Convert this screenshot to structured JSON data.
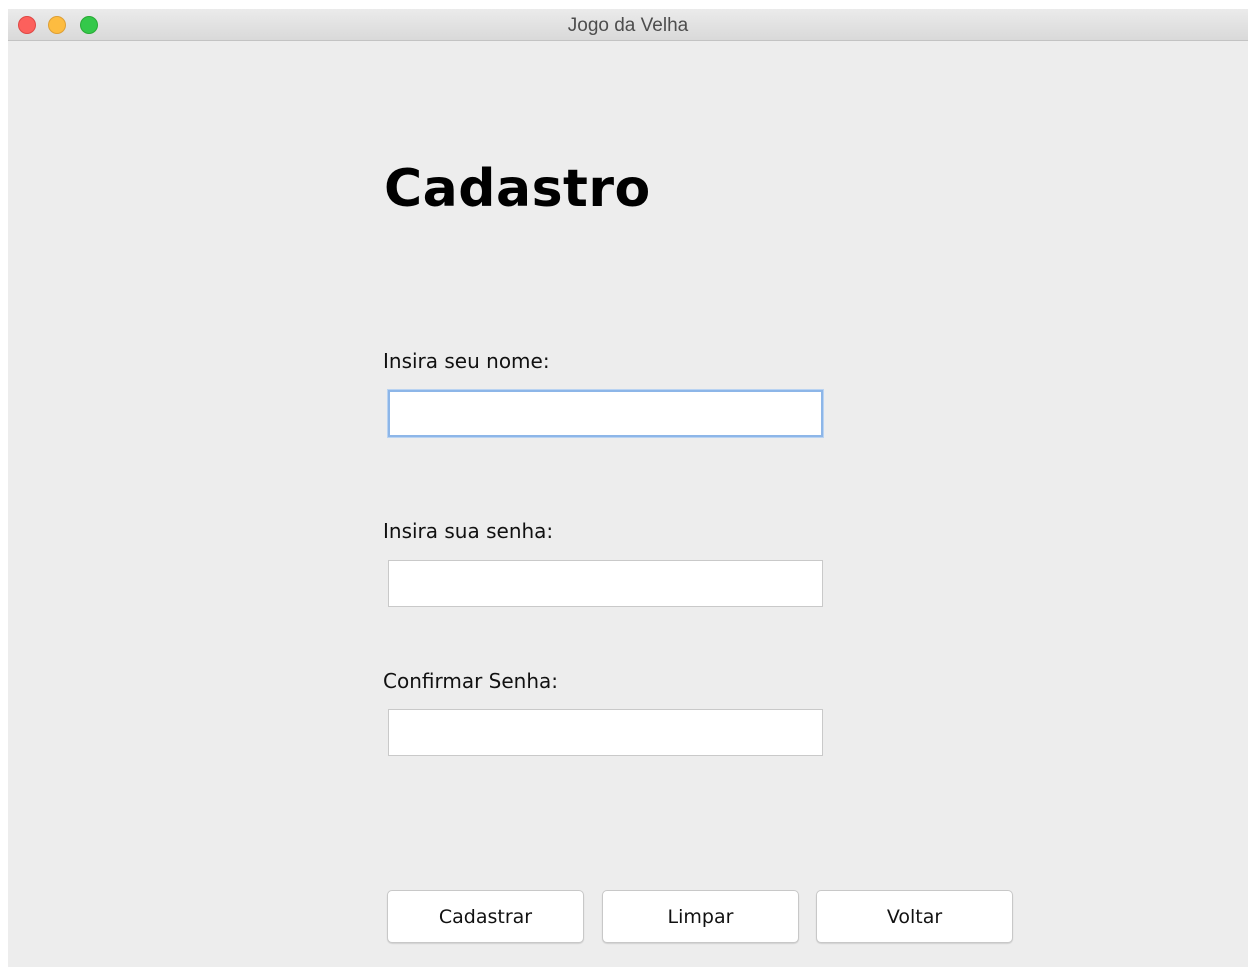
{
  "window": {
    "title": "Jogo da Velha",
    "controls": {
      "close_color": "#fc605c",
      "minimize_color": "#fdbc40",
      "zoom_color": "#34c84a"
    }
  },
  "form": {
    "heading": "Cadastro",
    "fields": [
      {
        "label": "Insira seu nome:",
        "value": "",
        "focused": true
      },
      {
        "label": "Insira sua senha:",
        "value": ""
      },
      {
        "label": "Confirmar Senha:",
        "value": ""
      }
    ]
  },
  "buttons": {
    "register_label": "Cadastrar",
    "clear_label": "Limpar",
    "back_label": "Voltar"
  },
  "colors": {
    "window_background": "#ededed",
    "focus_ring": "#8db6e8"
  }
}
